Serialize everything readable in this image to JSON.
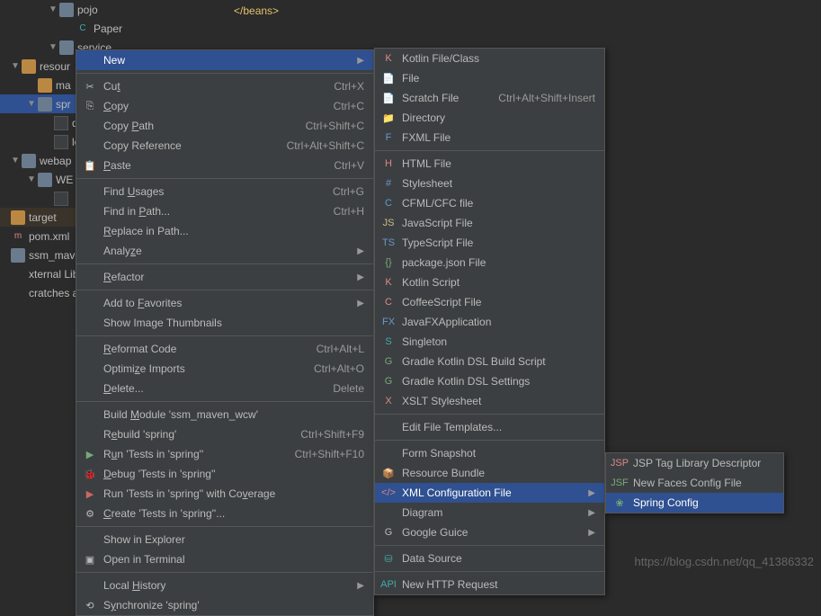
{
  "editor": {
    "closing_tag": "</beans>"
  },
  "tree": [
    {
      "i": 54,
      "a": "▼",
      "ic": "folder",
      "t": "pojo"
    },
    {
      "i": 72,
      "ic": "C",
      "cl": "cyan",
      "t": "Paper"
    },
    {
      "i": 54,
      "a": "▼",
      "ic": "folder",
      "t": "service"
    },
    {
      "i": 12,
      "a": "▼",
      "ic": "folder o",
      "t": "resour"
    },
    {
      "i": 30,
      "ic": "folder o",
      "t": "ma"
    },
    {
      "i": 30,
      "a": "▼",
      "ic": "folder",
      "t": "spr",
      "sel": true
    },
    {
      "i": 48,
      "ic": "file-ico",
      "t": "db"
    },
    {
      "i": 48,
      "ic": "file-ico",
      "t": "log"
    },
    {
      "i": 12,
      "a": "▼",
      "ic": "folder",
      "t": "webap"
    },
    {
      "i": 30,
      "a": "▼",
      "ic": "folder",
      "t": "WE"
    },
    {
      "i": 48,
      "ic": "file-ico",
      "t": ""
    },
    {
      "i": 0,
      "ic": "folder o",
      "t": "target",
      "sel2": true
    },
    {
      "i": 0,
      "ic": "m",
      "cl": "orange",
      "t": "pom.xml"
    },
    {
      "i": 0,
      "ic": "folder",
      "t": "ssm_maven_"
    },
    {
      "i": 0,
      "t": "xternal Librari"
    },
    {
      "i": 0,
      "t": "cratches and C"
    }
  ],
  "menu1": [
    {
      "t": "New",
      "hov": true,
      "sub": true
    },
    {
      "sep": 1
    },
    {
      "ic": "✂",
      "t": "Cut",
      "u": "t",
      "sc": "Ctrl+X"
    },
    {
      "ic": "⎘",
      "t": "Copy",
      "u": "C",
      "sc": "Ctrl+C"
    },
    {
      "t": "Copy Path",
      "u": "P",
      "sc": "Ctrl+Shift+C"
    },
    {
      "t": "Copy Reference",
      "sc": "Ctrl+Alt+Shift+C"
    },
    {
      "ic": "📋",
      "t": "Paste",
      "u": "P",
      "sc": "Ctrl+V"
    },
    {
      "sep": 1
    },
    {
      "t": "Find Usages",
      "u": "U",
      "sc": "Ctrl+G"
    },
    {
      "t": "Find in Path...",
      "u": "P",
      "sc": "Ctrl+H"
    },
    {
      "t": "Replace in Path...",
      "u": "R"
    },
    {
      "t": "Analyze",
      "u": "z",
      "sub": true
    },
    {
      "sep": 1
    },
    {
      "t": "Refactor",
      "u": "R",
      "sub": true
    },
    {
      "sep": 1
    },
    {
      "t": "Add to Favorites",
      "u": "F",
      "sub": true
    },
    {
      "t": "Show Image Thumbnails"
    },
    {
      "sep": 1
    },
    {
      "t": "Reformat Code",
      "u": "R",
      "sc": "Ctrl+Alt+L"
    },
    {
      "t": "Optimize Imports",
      "u": "z",
      "sc": "Ctrl+Alt+O"
    },
    {
      "t": "Delete...",
      "u": "D",
      "sc": "Delete"
    },
    {
      "sep": 1
    },
    {
      "t": "Build Module 'ssm_maven_wcw'",
      "u": "M"
    },
    {
      "t": "Rebuild 'spring'",
      "u": "e",
      "sc": "Ctrl+Shift+F9"
    },
    {
      "ic": "▶",
      "cl": "green",
      "t": "Run 'Tests in 'spring''",
      "u": "u",
      "sc": "Ctrl+Shift+F10"
    },
    {
      "ic": "🐞",
      "cl": "green",
      "t": "Debug 'Tests in 'spring''",
      "u": "D"
    },
    {
      "ic": "▶",
      "cl": "red",
      "t": "Run 'Tests in 'spring'' with Coverage",
      "u": "v"
    },
    {
      "ic": "⚙",
      "t": "Create 'Tests in 'spring''...",
      "u": "C"
    },
    {
      "sep": 1
    },
    {
      "t": "Show in Explorer"
    },
    {
      "ic": "▣",
      "t": "Open in Terminal"
    },
    {
      "sep": 1
    },
    {
      "t": "Local History",
      "u": "H",
      "sub": true
    },
    {
      "ic": "⟲",
      "t": "Synchronize 'spring'",
      "u": "y"
    }
  ],
  "menu2": [
    {
      "ic": "K",
      "cl": "orange",
      "t": "Kotlin File/Class"
    },
    {
      "ic": "📄",
      "t": "File"
    },
    {
      "ic": "📄",
      "t": "Scratch File",
      "sc": "Ctrl+Alt+Shift+Insert"
    },
    {
      "ic": "📁",
      "t": "Directory"
    },
    {
      "ic": "F",
      "cl": "blue",
      "t": "FXML File"
    },
    {
      "sep": 1
    },
    {
      "ic": "H",
      "cl": "orange",
      "t": "HTML File"
    },
    {
      "ic": "#",
      "cl": "blue",
      "t": "Stylesheet"
    },
    {
      "ic": "C",
      "cl": "blue",
      "t": "CFML/CFC file"
    },
    {
      "ic": "JS",
      "cl": "yel",
      "t": "JavaScript File"
    },
    {
      "ic": "TS",
      "cl": "blue",
      "t": "TypeScript File"
    },
    {
      "ic": "{}",
      "cl": "green",
      "t": "package.json File"
    },
    {
      "ic": "K",
      "cl": "orange",
      "t": "Kotlin Script"
    },
    {
      "ic": "C",
      "cl": "orange",
      "t": "CoffeeScript File"
    },
    {
      "ic": "FX",
      "cl": "blue",
      "t": "JavaFXApplication"
    },
    {
      "ic": "S",
      "cl": "cyan",
      "t": "Singleton"
    },
    {
      "ic": "G",
      "cl": "green",
      "t": "Gradle Kotlin DSL Build Script"
    },
    {
      "ic": "G",
      "cl": "green",
      "t": "Gradle Kotlin DSL Settings"
    },
    {
      "ic": "X",
      "cl": "orange",
      "t": "XSLT Stylesheet"
    },
    {
      "sep": 1
    },
    {
      "t": "Edit File Templates..."
    },
    {
      "sep": 1
    },
    {
      "t": "Form Snapshot"
    },
    {
      "ic": "📦",
      "t": "Resource Bundle"
    },
    {
      "ic": "</>",
      "cl": "orange",
      "t": "XML Configuration File",
      "hov": true,
      "sub": true
    },
    {
      "t": "Diagram",
      "sub": true
    },
    {
      "ic": "G",
      "t": "Google Guice",
      "sub": true
    },
    {
      "sep": 1
    },
    {
      "ic": "⛁",
      "cl": "cyan",
      "t": "Data Source"
    },
    {
      "sep": 1
    },
    {
      "ic": "API",
      "cl": "cyan",
      "t": "New HTTP Request"
    }
  ],
  "menu3": [
    {
      "ic": "JSP",
      "cl": "orange",
      "t": "JSP Tag Library Descriptor"
    },
    {
      "ic": "JSF",
      "cl": "green",
      "t": "New Faces Config File"
    },
    {
      "ic": "❀",
      "cl": "green",
      "t": "Spring Config",
      "hov": true
    }
  ],
  "watermark": "https://blog.csdn.net/qq_41386332"
}
